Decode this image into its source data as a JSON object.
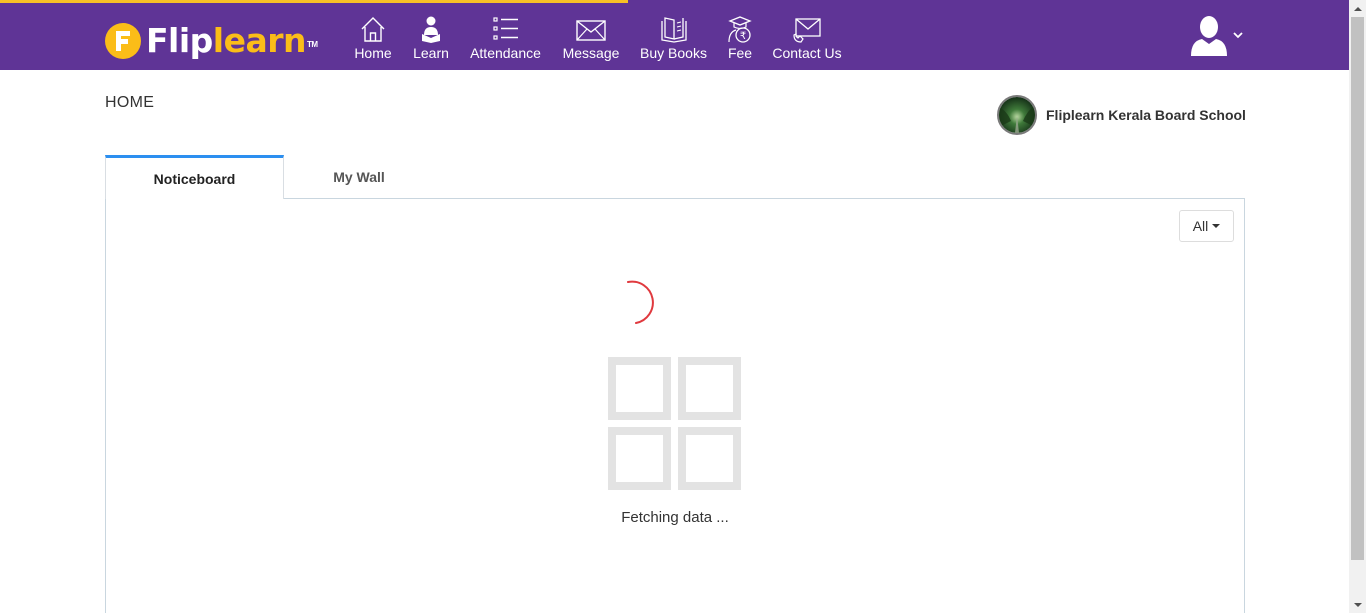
{
  "brand": {
    "logo_letter": "F",
    "logo_flip": "Flip",
    "logo_learn": "learn",
    "logo_tm": "TM",
    "purple": "#5f3496",
    "yellow": "#fbbd18"
  },
  "nav": {
    "items": [
      {
        "label": "Home",
        "icon": "house-icon"
      },
      {
        "label": "Learn",
        "icon": "student-reading-icon"
      },
      {
        "label": "Attendance",
        "icon": "checklist-icon"
      },
      {
        "label": "Message",
        "icon": "envelope-icon"
      },
      {
        "label": "Buy Books",
        "icon": "book-icon"
      },
      {
        "label": "Fee",
        "icon": "rupee-graduate-icon"
      },
      {
        "label": "Contact Us",
        "icon": "contact-mail-icon"
      }
    ]
  },
  "user": {
    "icon": "user-avatar-icon",
    "menu_icon": "chevron-down-icon"
  },
  "page": {
    "title": "HOME"
  },
  "school": {
    "name": "Fliplearn Kerala Board School"
  },
  "tabs": [
    {
      "label": "Noticeboard",
      "active": true
    },
    {
      "label": "My Wall",
      "active": false
    }
  ],
  "filter": {
    "selected": "All"
  },
  "loading": {
    "message": "Fetching data ..."
  },
  "colors": {
    "tab_active_border": "#2c8ff0",
    "spinner": "#e0393e"
  }
}
